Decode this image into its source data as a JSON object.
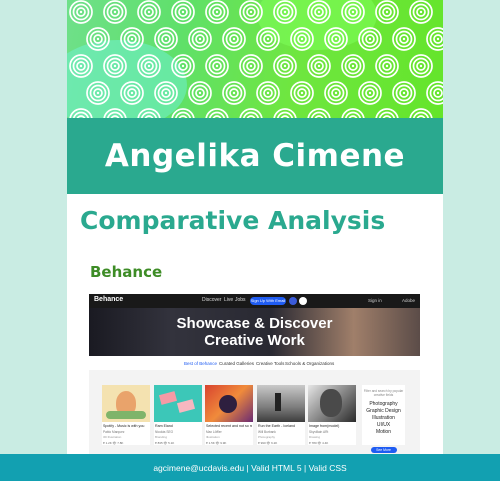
{
  "colors": {
    "page_background": "#c9ece3",
    "name_band": "#2aa98f",
    "section_title": "#2aa98f",
    "subsection_title": "#3d8c26",
    "footer": "#12a0b1",
    "behance_blue": "#1f5cf2"
  },
  "header": {
    "banner_pattern": "green-concentric-circles",
    "name": "Angelika Cimene"
  },
  "main": {
    "section_title": "Comparative Analysis",
    "subsection_title": "Behance"
  },
  "behance_screenshot": {
    "logo": "Behance",
    "nav_links": [
      "Discover",
      "Live",
      "Jobs"
    ],
    "signup_button": "Sign Up With Email",
    "nav_right": [
      "Sign in",
      "Adobe"
    ],
    "hero_line1": "Showcase & Discover",
    "hero_line2": "Creative Work",
    "tabs": [
      "Best of Behance",
      "Curated Galleries",
      "Creative Tools",
      "Schools & Organizations"
    ],
    "cards": [
      {
        "title": "Spotify - Music is with you",
        "owner": "Pablo Marquez",
        "field": "3D Illustration",
        "stats": "♥ 1.2K  👁 7.8K"
      },
      {
        "title": "Ram Eland",
        "owner": "Nicolás SEO",
        "field": "Branding",
        "stats": "♥ 835  👁 5.1K"
      },
      {
        "title": "Selected recent and not so recent projects 5",
        "owner": "Max Löffler",
        "field": "Illustration",
        "stats": "♥ 1.5K  👁 9.9K"
      },
      {
        "title": "Run the Earth - Iceland",
        "owner": "Will Burbank",
        "field": "Photography",
        "stats": "♥ 990  👁 6.2K"
      },
      {
        "title": "Image from(model)",
        "owner": "Skyvillain ARt",
        "field": "Drawing",
        "stats": "♥ 780  👁 4.4K"
      }
    ],
    "filter_caption": "Filter and search by popular creative fields",
    "filter_items": [
      "Photography",
      "Graphic Design",
      "Illustration",
      "UI/UX",
      "Motion"
    ],
    "filter_button": "See More"
  },
  "footer": {
    "text": "agcimene@ucdavis.edu | Valid HTML 5 | Valid CSS"
  }
}
